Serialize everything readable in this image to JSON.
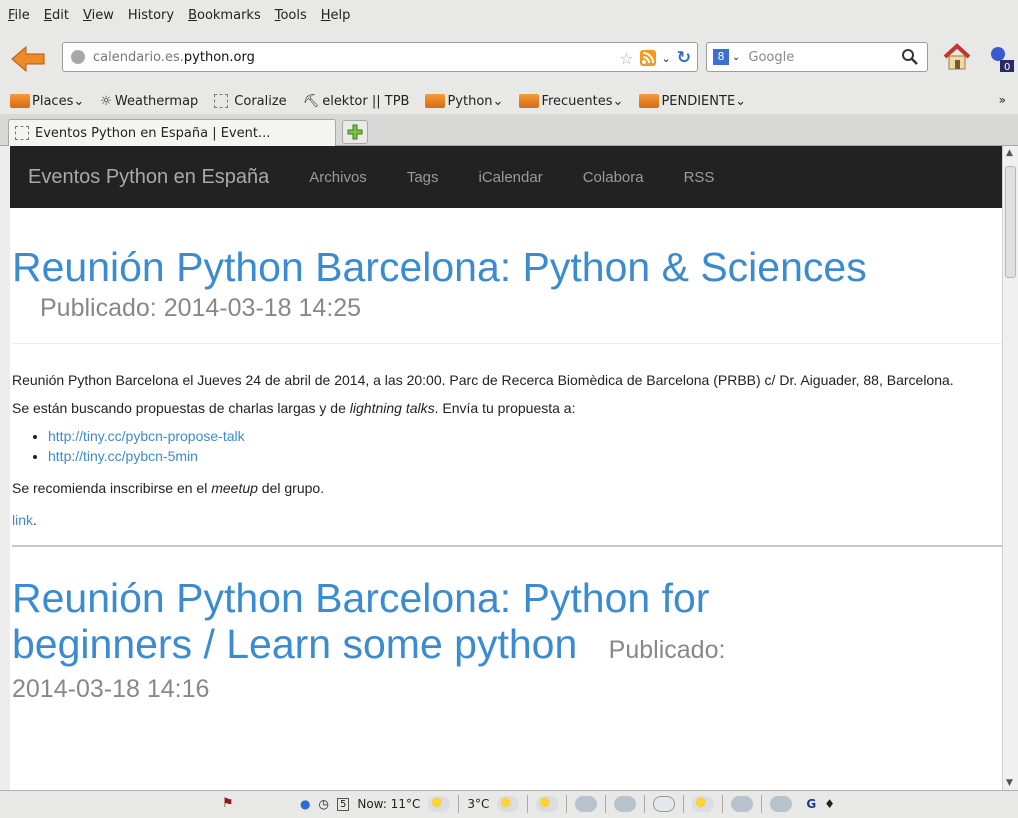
{
  "menu": [
    "File",
    "Edit",
    "View",
    "History",
    "Bookmarks",
    "Tools",
    "Help"
  ],
  "urlbar": {
    "domain_prefix": "calendario.es.",
    "domain_main": "python.org"
  },
  "search": {
    "placeholder": "Google",
    "engine": "Google"
  },
  "bookmarks": [
    {
      "label": "Places",
      "type": "folder"
    },
    {
      "label": "Weathermap",
      "type": "link"
    },
    {
      "label": "Coralize",
      "type": "link"
    },
    {
      "label": "elektor || TPB",
      "type": "link"
    },
    {
      "label": "Python",
      "type": "folder"
    },
    {
      "label": "Frecuentes",
      "type": "folder"
    },
    {
      "label": "PENDIENTE",
      "type": "folder"
    }
  ],
  "bookmarks_more": "»",
  "tab": {
    "title": "Eventos Python en España | Event..."
  },
  "site": {
    "brand": "Eventos Python en España",
    "nav": [
      "Archivos",
      "Tags",
      "iCalendar",
      "Colabora",
      "RSS"
    ]
  },
  "post1": {
    "title": "Reunión Python Barcelona: Python & Sciences",
    "published": "Publicado: 2014-03-18 14:25",
    "para1": "Reunión Python Barcelona el Jueves 24 de abril de 2014, a las 20:00. Parc de Recerca Biomèdica de Barcelona (PRBB) c/ Dr. Aiguader, 88, Barcelona.",
    "para2_a": "Se están buscando propuestas de charlas largas y de ",
    "para2_em": "lightning talks",
    "para2_b": ". Envía tu propuesta a:",
    "links": [
      "http://tiny.cc/pybcn-propose-talk",
      "http://tiny.cc/pybcn-5min"
    ],
    "para3_a": "Se recomienda inscribirse en el ",
    "para3_em": "meetup",
    "para3_b": " del grupo.",
    "link_label": "link",
    "link_dot": "."
  },
  "post2": {
    "title_line1": "Reunión Python Barcelona: Python for",
    "title_line2": "beginners / Learn some python",
    "published_label": "Publicado:",
    "published_date": "2014-03-18 14:16"
  },
  "status": {
    "now": "Now: 11°C",
    "next": "3°C"
  }
}
